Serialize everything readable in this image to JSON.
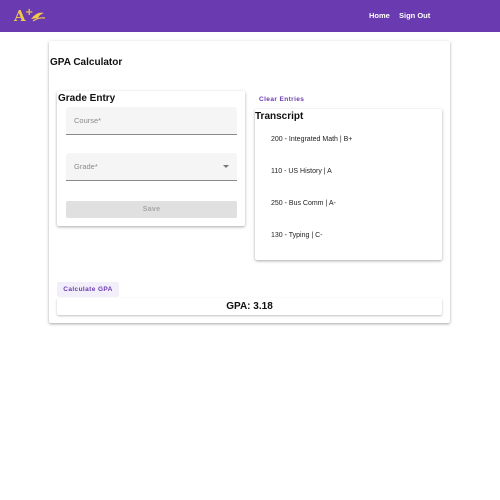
{
  "header": {
    "logo_text": "A+",
    "nav": [
      {
        "label": "Home"
      },
      {
        "label": "Sign Out"
      }
    ],
    "colors": {
      "bar": "#6a3ab0",
      "logo": "#f2c94c"
    }
  },
  "page": {
    "title": "GPA Calculator"
  },
  "grade_entry": {
    "title": "Grade Entry",
    "course_label": "Course*",
    "grade_label": "Grade*",
    "save_label": "Save"
  },
  "clear_entries_label": "Clear Entries",
  "transcript": {
    "title": "Transcript",
    "items": [
      "200 - Integrated Math | B+",
      "110 - US History | A",
      "250 - Bus Comm | A-",
      "130 - Typing | C-"
    ]
  },
  "calculate_label": "Calculate GPA",
  "gpa_result": "GPA: 3.18"
}
